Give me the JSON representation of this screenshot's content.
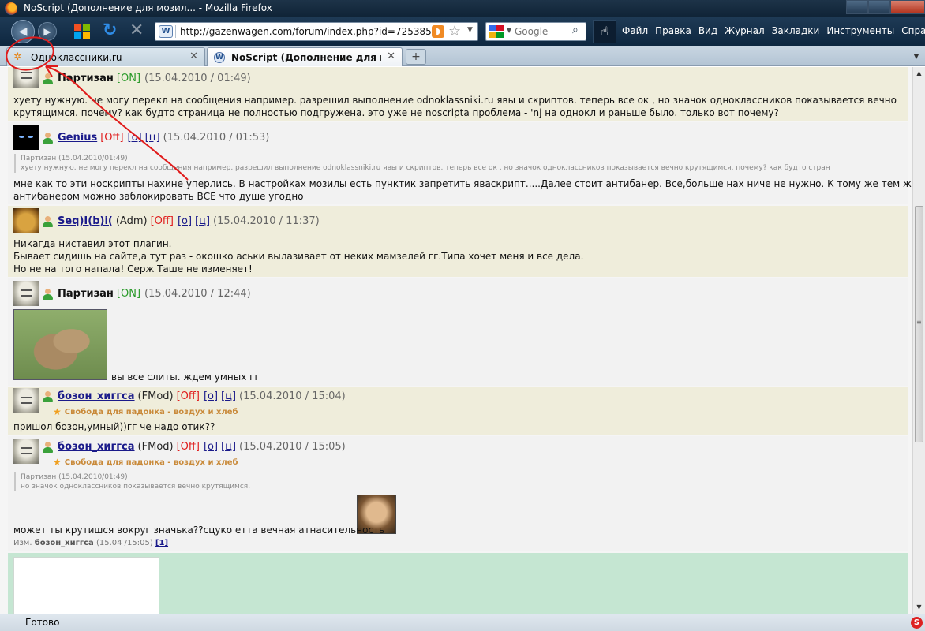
{
  "window": {
    "title": "NoScript (Дополнение для мозил... - Mozilla Firefox"
  },
  "toolbar": {
    "url": "http://gazenwagen.com/forum/index.php?id=725385",
    "search_placeholder": "Google",
    "menu": [
      "Файл",
      "Правка",
      "Вид",
      "Журнал",
      "Закладки",
      "Инструменты",
      "Справка"
    ]
  },
  "tabs": [
    {
      "label": "Одноклассники.ru",
      "active": false
    },
    {
      "label": "NoScript (Дополнение для мози...",
      "active": true
    }
  ],
  "posts": [
    {
      "user": "Партизан",
      "status": "[ON]",
      "date": "(15.04.2010 / 01:49)",
      "lines": [
        "хуету нужную. не могу перекл на сообщения например. разрешил выполнение odnoklassniki.ru явы и скриптов. теперь все ок , но значок одноклассников показывается вечно",
        "крутящимся. почему? как будто страница не полностью подгружена. это уже не noscripta проблема - 'nj на однокл и раньше было. только вот почему?"
      ]
    },
    {
      "user": "Genius",
      "status": "[Off]",
      "link_o": "[о]",
      "link_c": "[ц]",
      "date": "(15.04.2010 / 01:53)",
      "quote": [
        "Партизан (15.04.2010/01:49)",
        "хуету нужную. не могу перекл на сообщения например. разрешил выполнение odnoklassniki.ru явы и скриптов. теперь все ок , но значок одноклассников показывается вечно крутящимся. почему? как будто стран"
      ],
      "lines": [
        "мне как то эти носкрипты нахине уперлись. В настройках мозилы есть пунктик запретить яваскрипт.....Далее стоит антибанер. Все,больше нах ниче не нужно. К тому же тем же",
        "антибанером можно заблокировать ВСЕ что душе угодно"
      ]
    },
    {
      "user": "Seq)I(b)i(",
      "role": "(Adm)",
      "status": "[Off]",
      "link_o": "[о]",
      "link_c": "[ц]",
      "date": "(15.04.2010 / 11:37)",
      "lines": [
        "Никагда ниставил этот плагин.",
        "Бывает сидишь на сайте,а тут раз - окошко аськи вылазивает от неких мамзелей гг.Типа хочет меня и все дела.",
        "Но не на того напала! Серж Таше не изменяет!"
      ]
    },
    {
      "user": "Партизан",
      "status": "[ON]",
      "date": "(15.04.2010 / 12:44)",
      "image_caption": "вы все слиты. ждем умных гг"
    },
    {
      "user": "бозон_хиггса",
      "role": "(FMod)",
      "status": "[Off]",
      "link_o": "[о]",
      "link_c": "[ц]",
      "date": "(15.04.2010 / 15:04)",
      "status_text": "Свобода для падонка - воздух и хлеб",
      "lines": [
        "пришол бозон,умный))гг че надо отик??"
      ]
    },
    {
      "user": "бозон_хиггса",
      "role": "(FMod)",
      "status": "[Off]",
      "link_o": "[о]",
      "link_c": "[ц]",
      "date": "(15.04.2010 / 15:05)",
      "status_text": "Свобода для падонка - воздух и хлеб",
      "quote": [
        "Партизан (15.04.2010/01:49)",
        "но значок одноклассников показывается вечно крутящимся."
      ],
      "lines": [
        "может ты крутишся вокруг значька??сцуко етта вечная атнасительность"
      ],
      "edited_prefix": "Изм.",
      "edited_user": "бозон_хиггса",
      "edited_date": "(15.04 /15:05)",
      "edited_count": "[1]"
    }
  ],
  "statusbar": {
    "text": "Готово"
  },
  "colors": {
    "post_odd": "#efeddb",
    "post_even": "#f2f2f2",
    "online": "#2a9a2a",
    "offline": "#e01b1b",
    "annotation": "#e01b1b"
  }
}
